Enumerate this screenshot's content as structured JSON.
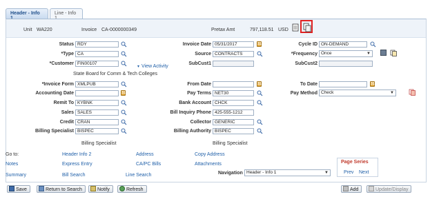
{
  "tabs": [
    {
      "label": "Header - Info 1"
    },
    {
      "label": "Line - Info 1"
    }
  ],
  "header": {
    "unit_label": "Unit",
    "unit_value": "WA220",
    "invoice_label": "Invoice",
    "invoice_value": "CA-0000000349",
    "pretax_label": "Pretax Amt",
    "pretax_value": "797,118.51",
    "currency": "USD"
  },
  "fields": {
    "status_label": "Status",
    "status_value": "RDY",
    "type_label": "*Type",
    "type_value": "CA",
    "customer_label": "*Customer",
    "customer_value": "FIN00107",
    "view_activity": "View Activity",
    "customer_name": "State Board for Comm & Tech Colleges",
    "invoice_date_label": "Invoice Date",
    "invoice_date_value": "05/31/2017",
    "source_label": "Source",
    "source_value": "CONTRACTS",
    "subcust1_label": "SubCust1",
    "subcust1_value": "",
    "cycle_id_label": "Cycle ID",
    "cycle_id_value": "ON-DEMAND",
    "frequency_label": "*Frequency",
    "frequency_value": "Once",
    "subcust2_label": "SubCust2",
    "subcust2_value": "",
    "invoice_form_label": "*Invoice Form",
    "invoice_form_value": "XMLPUB",
    "accounting_date_label": "Accounting Date",
    "accounting_date_value": "",
    "remit_to_label": "Remit To",
    "remit_to_value": "KYBNK",
    "sales_label": "Sales",
    "sales_value": "SALES",
    "credit_label": "Credit",
    "credit_value": "CRAN",
    "billing_specialist_label": "Billing Specialist",
    "billing_specialist_value": "BISPEC",
    "billing_specialist_desc": "Billing Specialist",
    "from_date_label": "From Date",
    "from_date_value": "",
    "pay_terms_label": "Pay Terms",
    "pay_terms_value": "NET30",
    "bank_account_label": "Bank Account",
    "bank_account_value": "CHCK",
    "bill_inquiry_phone_label": "Bill Inquiry Phone",
    "bill_inquiry_phone_value": "425-555-1212",
    "collector_label": "Collector",
    "collector_value": "GENERIC",
    "billing_authority_label": "Billing Authority",
    "billing_authority_value": "BISPEC",
    "billing_authority_desc": "Billing Specialist",
    "to_date_label": "To Date",
    "to_date_value": "",
    "pay_method_label": "Pay Method",
    "pay_method_value": "Check"
  },
  "goto": {
    "label": "Go to:",
    "links": [
      "Header Info 2",
      "Address",
      "Copy Address",
      "Notes",
      "Express Entry",
      "CA/PC Bills",
      "Attachments",
      "Summary",
      "Bill Search",
      "Line Search"
    ]
  },
  "navigation": {
    "label": "Navigation",
    "value": "Header - Info 1"
  },
  "page_series": {
    "title": "Page Series",
    "prev": "Prev",
    "next": "Next"
  },
  "toolbar": {
    "save": "Save",
    "return_to_search": "Return to Search",
    "notify": "Notify",
    "refresh": "Refresh",
    "add": "Add",
    "update_display": "Update/Display"
  },
  "colors": {
    "link": "#1f5fa8",
    "highlight": "#e02020",
    "accent": "#1f4f8b"
  }
}
